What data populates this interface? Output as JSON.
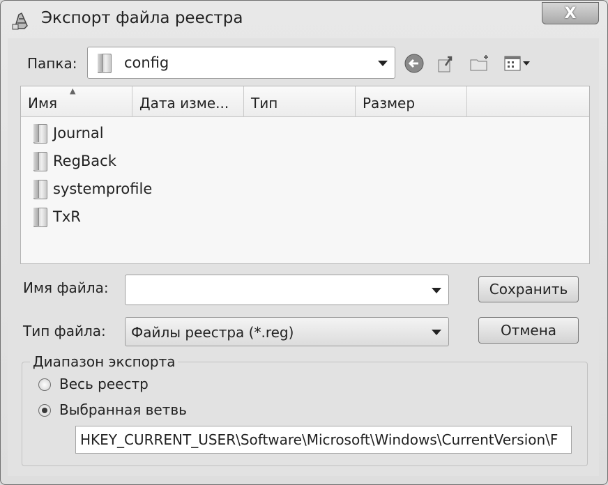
{
  "window": {
    "title": "Экспорт файла реестра",
    "close_glyph": "X"
  },
  "location": {
    "label": "Папка:",
    "current_folder": "config"
  },
  "toolbar": {
    "back_icon": "back-icon",
    "up_icon": "up-folder-icon",
    "new_folder_icon": "new-folder-icon",
    "views_icon": "views-menu-icon"
  },
  "columns": [
    "Имя",
    "Дата изме...",
    "Тип",
    "Размер"
  ],
  "files": [
    {
      "name": "Journal"
    },
    {
      "name": "RegBack"
    },
    {
      "name": "systemprofile"
    },
    {
      "name": "TxR"
    }
  ],
  "filename": {
    "label": "Имя файла:",
    "value": ""
  },
  "filetype": {
    "label": "Тип файла:",
    "value": "Файлы реестра (*.reg)"
  },
  "buttons": {
    "save": "Сохранить",
    "cancel": "Отмена"
  },
  "export_range": {
    "title": "Диапазон экспорта",
    "option_all": "Весь реестр",
    "option_branch": "Выбранная ветвь",
    "selected": "branch",
    "branch_path": "HKEY_CURRENT_USER\\Software\\Microsoft\\Windows\\CurrentVersion\\F"
  }
}
